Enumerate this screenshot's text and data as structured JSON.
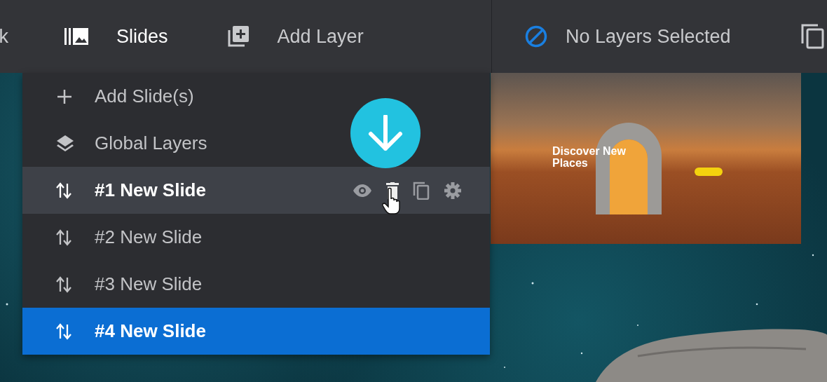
{
  "toolbar": {
    "cut_label": "k",
    "items": [
      {
        "kind": "slides",
        "label": "Slides",
        "selected": true
      },
      {
        "kind": "add-layer",
        "label": "Add Layer",
        "selected": false
      }
    ],
    "selection": {
      "label": "No Layers Selected"
    }
  },
  "menu": {
    "actions": [
      {
        "kind": "add",
        "label": "Add Slide(s)"
      },
      {
        "kind": "layers",
        "label": "Global Layers"
      }
    ],
    "slides": [
      {
        "label": "#1 New Slide",
        "selected": false,
        "hovered": true
      },
      {
        "label": "#2 New Slide",
        "selected": false,
        "hovered": false
      },
      {
        "label": "#3 New Slide",
        "selected": false,
        "hovered": false
      },
      {
        "label": "#4 New Slide",
        "selected": true,
        "hovered": false
      }
    ]
  },
  "preview": {
    "headline": "Discover New Places"
  }
}
